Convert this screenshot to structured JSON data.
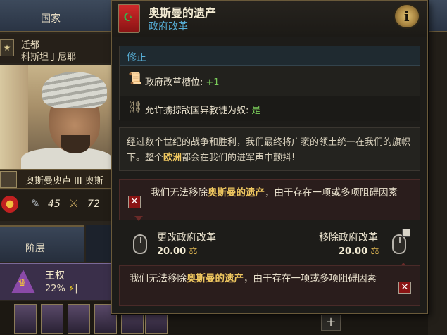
{
  "background": {
    "tab_label": "国家",
    "capital": {
      "title": "迁都",
      "name": "科斯坦丁尼耶"
    },
    "ruler_name": "奥斯曼奥卢 III 奥斯",
    "stats": {
      "a": "45",
      "b": "72"
    },
    "tab2_label": "阶层",
    "estate": {
      "label": "王权",
      "percent": "22%",
      "suffix": "|"
    }
  },
  "tooltip": {
    "title": "奥斯曼的遗产",
    "subtitle": "政府改革",
    "info_icon": "i",
    "modifiers_header": "修正",
    "modifiers": [
      {
        "icon": "scroll-icon",
        "label": "政府改革槽位:",
        "value": "+1"
      },
      {
        "icon": "chain-icon",
        "label": "允许掳掠敌国异教徒为奴:",
        "value": "是"
      }
    ],
    "description_part1": "经过数个世纪的战争和胜利，我们最终将广袤的领土统一在我们的旗帜下。整个",
    "description_highlight": "欧洲",
    "description_part2": "都会在我们的进军声中颤抖!",
    "warning_prefix": "我们无法移除",
    "warning_highlight": "奥斯曼的遗产",
    "warning_suffix": "，由于存在一项或多项阻碍因素",
    "change_label": "更改政府改革",
    "change_cost": "20.00",
    "remove_label": "移除政府改革",
    "remove_cost": "20.00",
    "warning2_prefix": "我们无法移除",
    "warning2_highlight": "奥斯曼的遗产",
    "warning2_suffix": "，由于存在一项或多项阻碍因素"
  },
  "colors": {
    "accent_blue": "#58b0d8",
    "positive_green": "#7acc5a",
    "highlight_gold": "#f0c860",
    "error_red": "#8a1414"
  }
}
